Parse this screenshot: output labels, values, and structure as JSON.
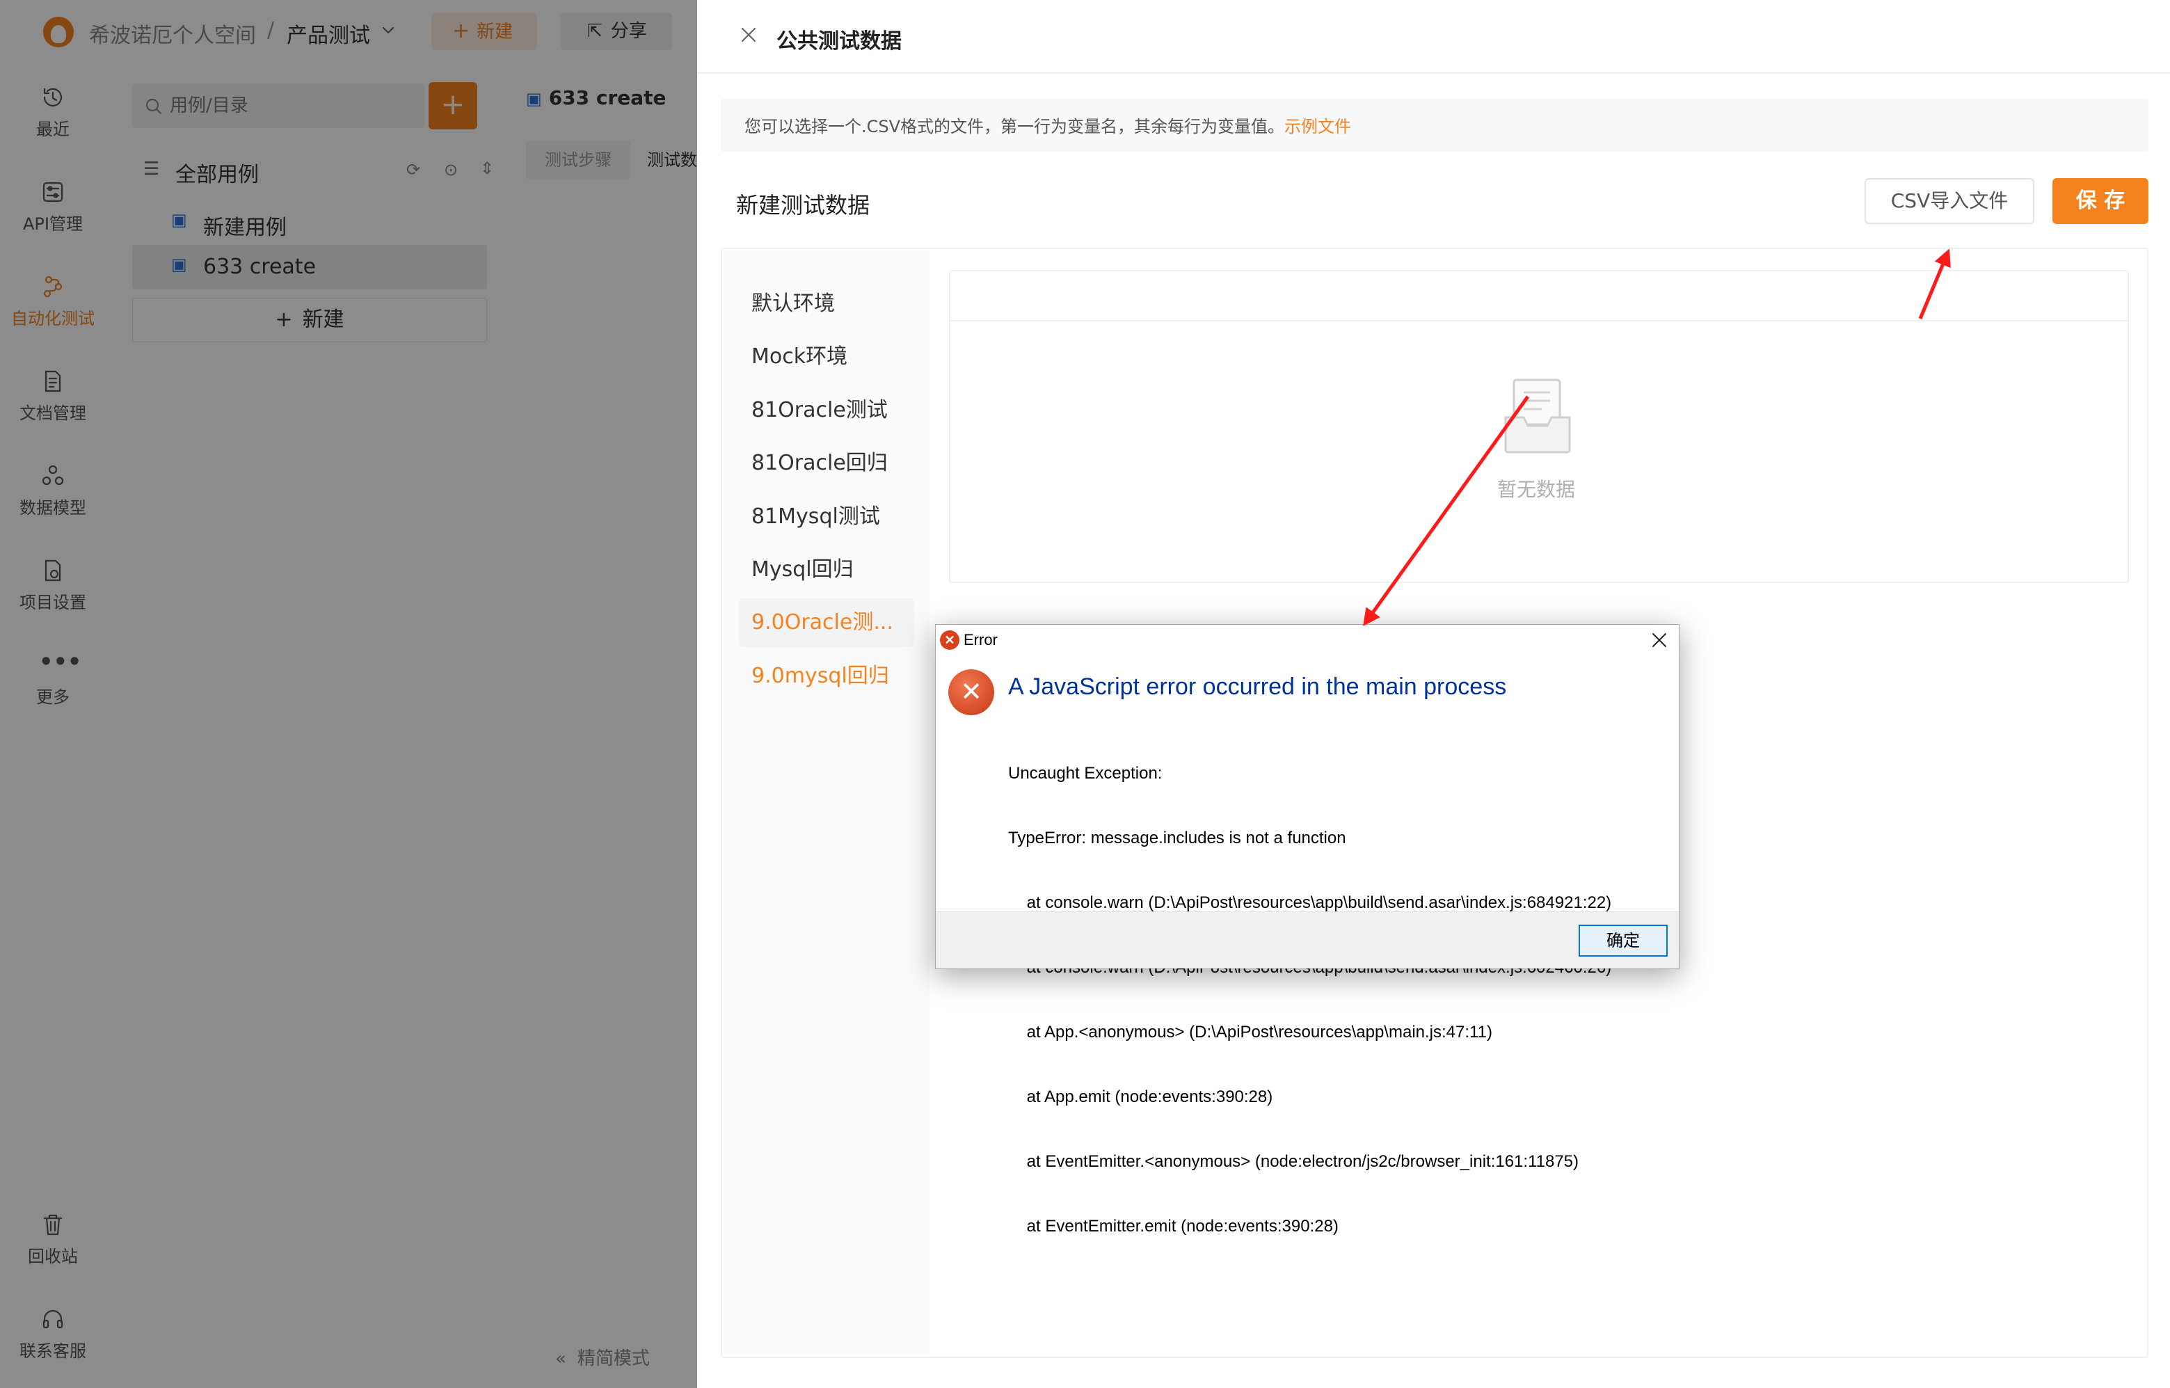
{
  "app": {
    "workspace": "希波诺厄个人空间",
    "separator": "/",
    "project": "产品测试",
    "new_button": "新建",
    "share_button": "分享"
  },
  "nav": {
    "items": [
      {
        "label": "最近",
        "icon": "history-icon"
      },
      {
        "label": "API管理",
        "icon": "api-icon"
      },
      {
        "label": "自动化测试",
        "icon": "automation-icon"
      },
      {
        "label": "文档管理",
        "icon": "document-icon"
      },
      {
        "label": "数据模型",
        "icon": "data-model-icon"
      },
      {
        "label": "项目设置",
        "icon": "settings-icon"
      },
      {
        "label": "更多",
        "icon": "more-icon"
      }
    ],
    "bottom": [
      {
        "label": "回收站",
        "icon": "trash-icon"
      },
      {
        "label": "联系客服",
        "icon": "headset-icon"
      }
    ]
  },
  "tree": {
    "search_placeholder": "用例/目录",
    "root_label": "全部用例",
    "items": [
      "新建用例",
      "633 create"
    ],
    "new_label": "新建"
  },
  "main": {
    "title": "633 create",
    "tabs": [
      "测试步骤",
      "测试数"
    ],
    "footer": "精简模式"
  },
  "drawer": {
    "title": "公共测试数据",
    "info_text": "您可以选择一个.CSV格式的文件，第一行为变量名，其余每行为变量值。",
    "info_link": "示例文件",
    "section_title": "新建测试数据",
    "csv_button": "CSV导入文件",
    "save_button": "保 存",
    "environments": [
      "默认环境",
      "Mock环境",
      "81Oracle测试",
      "81Oracle回归",
      "81Mysql测试",
      "Mysql回归",
      "9.0Oracle测...",
      "9.0mysql回归"
    ],
    "selected_env": 6,
    "empty_text": "暂无数据"
  },
  "dialog": {
    "window_title": "Error",
    "heading": "A JavaScript error occurred in the main process",
    "lines": [
      "Uncaught Exception:",
      "TypeError: message.includes is not a function",
      "    at console.warn (D:\\ApiPost\\resources\\app\\build\\send.asar\\index.js:684921:22)",
      "    at console.warn (D:\\ApiPost\\resources\\app\\build\\send.asar\\index.js:602460:26)",
      "    at App.<anonymous> (D:\\ApiPost\\resources\\app\\main.js:47:11)",
      "    at App.emit (node:events:390:28)",
      "    at EventEmitter.<anonymous> (node:electron/js2c/browser_init:161:11875)",
      "    at EventEmitter.emit (node:events:390:28)"
    ],
    "ok_button": "确定"
  },
  "colors": {
    "accent": "#f5821f",
    "error_red": "#d9401c",
    "dialog_heading": "#003399",
    "annotation_arrow": "#ff1a1a"
  }
}
